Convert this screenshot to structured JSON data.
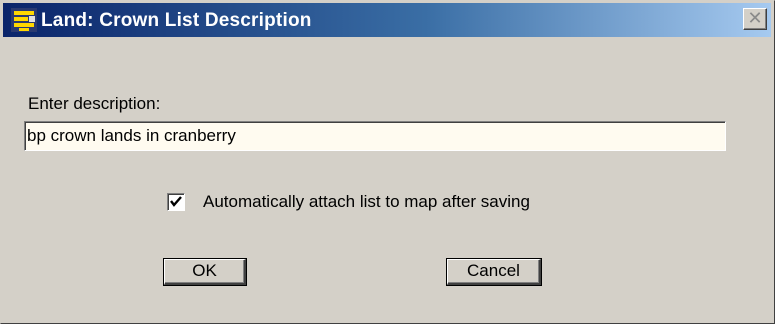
{
  "window": {
    "title": "Land: Crown List Description",
    "icon": "land-app-icon",
    "close_glyph": "✕"
  },
  "form": {
    "prompt_label": "Enter description:",
    "description_value": "bp crown lands in cranberry",
    "auto_attach_checked": true,
    "auto_attach_label": "Automatically attach list to map after saving"
  },
  "buttons": {
    "ok_label": "OK",
    "cancel_label": "Cancel"
  },
  "colors": {
    "titlebar_start": "#0a246a",
    "titlebar_end": "#a6caf0",
    "dialog_bg": "#d4d0c8",
    "input_bg": "#fffbf0"
  }
}
